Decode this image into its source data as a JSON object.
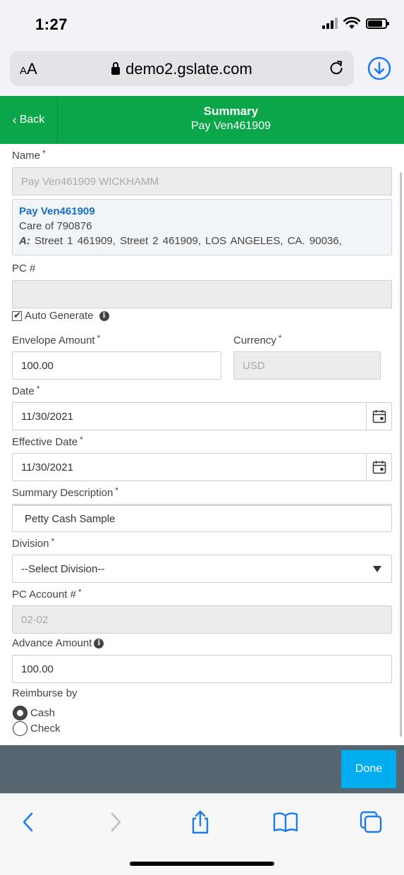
{
  "status_bar": {
    "time": "1:27"
  },
  "browser": {
    "aa_label_big": "A",
    "aa_label_small": "A",
    "url": "demo2.gslate.com",
    "accent": "#1a7cf0"
  },
  "header": {
    "back_label": "Back",
    "title": "Summary",
    "subtitle": "Pay Ven461909",
    "color": "#0aa649"
  },
  "form": {
    "required_mark": "*",
    "name": {
      "label": "Name",
      "value": "Pay Ven461909 WICKHAMM"
    },
    "vendor": {
      "name": "Pay Ven461909",
      "care_of": "Care of 790876",
      "address_prefix": "A:",
      "address": "Street 1 461909,   Street 2 461909,   LOS ANGELES,   CA.   90036,"
    },
    "pc_number": {
      "label": "PC #",
      "value": ""
    },
    "auto_generate": {
      "label": "Auto Generate",
      "checked": true
    },
    "envelope_amount": {
      "label": "Envelope Amount",
      "value": "100.00"
    },
    "currency": {
      "label": "Currency",
      "value": "USD"
    },
    "date": {
      "label": "Date",
      "value": "11/30/2021"
    },
    "effective_date": {
      "label": "Effective Date",
      "value": "11/30/2021"
    },
    "summary_description": {
      "label": "Summary Description",
      "value": "Petty Cash Sample"
    },
    "division": {
      "label": "Division",
      "selected": "--Select Division--"
    },
    "pc_account": {
      "label": "PC Account #",
      "value": "02-02"
    },
    "advance_amount": {
      "label": "Advance Amount",
      "value": "100.00"
    },
    "reimburse_by": {
      "label": "Reimburse by",
      "options": [
        {
          "label": "Cash",
          "selected": true
        },
        {
          "label": "Check",
          "selected": false
        }
      ]
    }
  },
  "footer": {
    "done_label": "Done",
    "done_color": "#00aef0"
  },
  "toolbar": {
    "icons": [
      "back-icon",
      "forward-icon",
      "share-icon",
      "bookmarks-icon",
      "tabs-icon"
    ]
  }
}
